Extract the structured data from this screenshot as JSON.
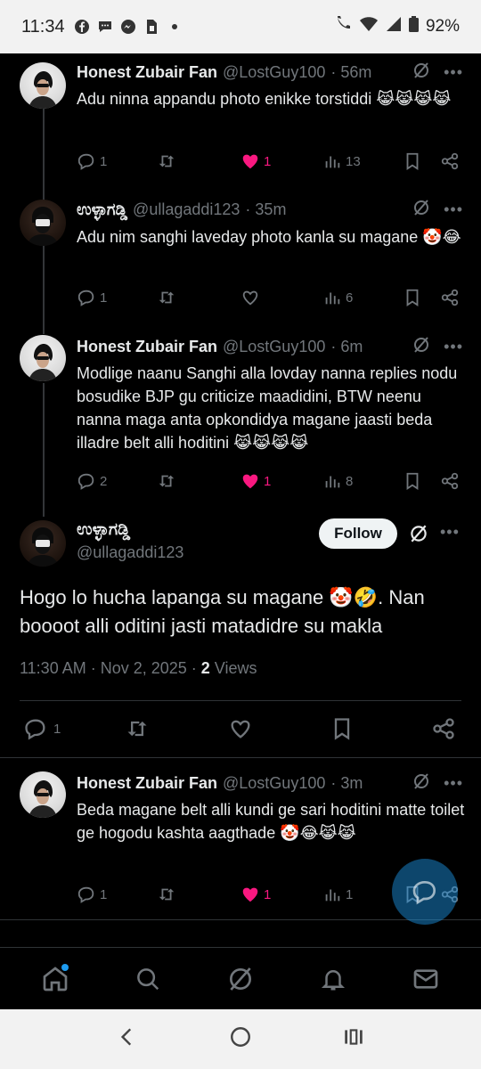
{
  "status_bar": {
    "time": "11:34",
    "battery": "92%",
    "left_icons": [
      "facebook-icon",
      "chat-icon",
      "messenger-icon",
      "sim-icon"
    ],
    "right_icons": [
      "wifi-call-icon",
      "wifi-icon",
      "signal-icon",
      "battery-icon"
    ]
  },
  "colors": {
    "background": "#000000",
    "text": "#e7e9ea",
    "muted": "#71767b",
    "like": "#f91880",
    "accent": "#1d9bf0",
    "divider": "#2f3336"
  },
  "tweets": [
    {
      "name": "Honest Zubair Fan",
      "handle": "@LostGuy100",
      "time": "· 56m",
      "text": "Adu ninna appandu photo enikke torstiddi 😹😹😹😹",
      "replies": "1",
      "reposts": "",
      "likes": "1",
      "liked": true,
      "views": "13"
    },
    {
      "name": "ಉಳ್ಳಾಗಡ್ಡಿ",
      "handle": "@ullagaddi123",
      "time": "· 35m",
      "text": "Adu nim sanghi laveday photo kanla su magane 🤡😂",
      "replies": "1",
      "reposts": "",
      "likes": "",
      "liked": false,
      "views": "6"
    },
    {
      "name": "Honest Zubair Fan",
      "handle": "@LostGuy100",
      "time": "· 6m",
      "text": "Modlige naanu Sanghi alla lovday nanna replies nodu bosudike BJP gu criticize maadidini, BTW neenu nanna maga anta opkondidya magane jaasti beda illadre belt alli hoditini 😹😹😹😹",
      "replies": "2",
      "reposts": "",
      "likes": "1",
      "liked": true,
      "views": "8"
    }
  ],
  "focused_tweet": {
    "name": "ಉಳ್ಳಾಗಡ್ಡಿ",
    "handle": "@ullagaddi123",
    "follow_label": "Follow",
    "text": "Hogo lo hucha lapanga su magane 🤡🤣. Nan boooot alli oditini jasti matadidre su makla",
    "timestamp": "11:30 AM · Nov 2, 2025 · ",
    "views_count": "2",
    "views_label": " Views",
    "replies": "1"
  },
  "reply_tweet": {
    "name": "Honest Zubair Fan",
    "handle": "@LostGuy100",
    "time": "· 3m",
    "text": "Beda magane belt alli kundi ge sari hoditini matte toilet ge hogodu kashta aagthade 🤡😂😹😹",
    "replies": "1",
    "reposts": "",
    "likes": "1",
    "liked": true,
    "views": "1"
  },
  "bottom_nav": [
    "home-icon",
    "search-icon",
    "grok-icon",
    "notifications-icon",
    "messages-icon"
  ],
  "system_nav": [
    "back-icon",
    "home-circle-icon",
    "recents-icon"
  ]
}
